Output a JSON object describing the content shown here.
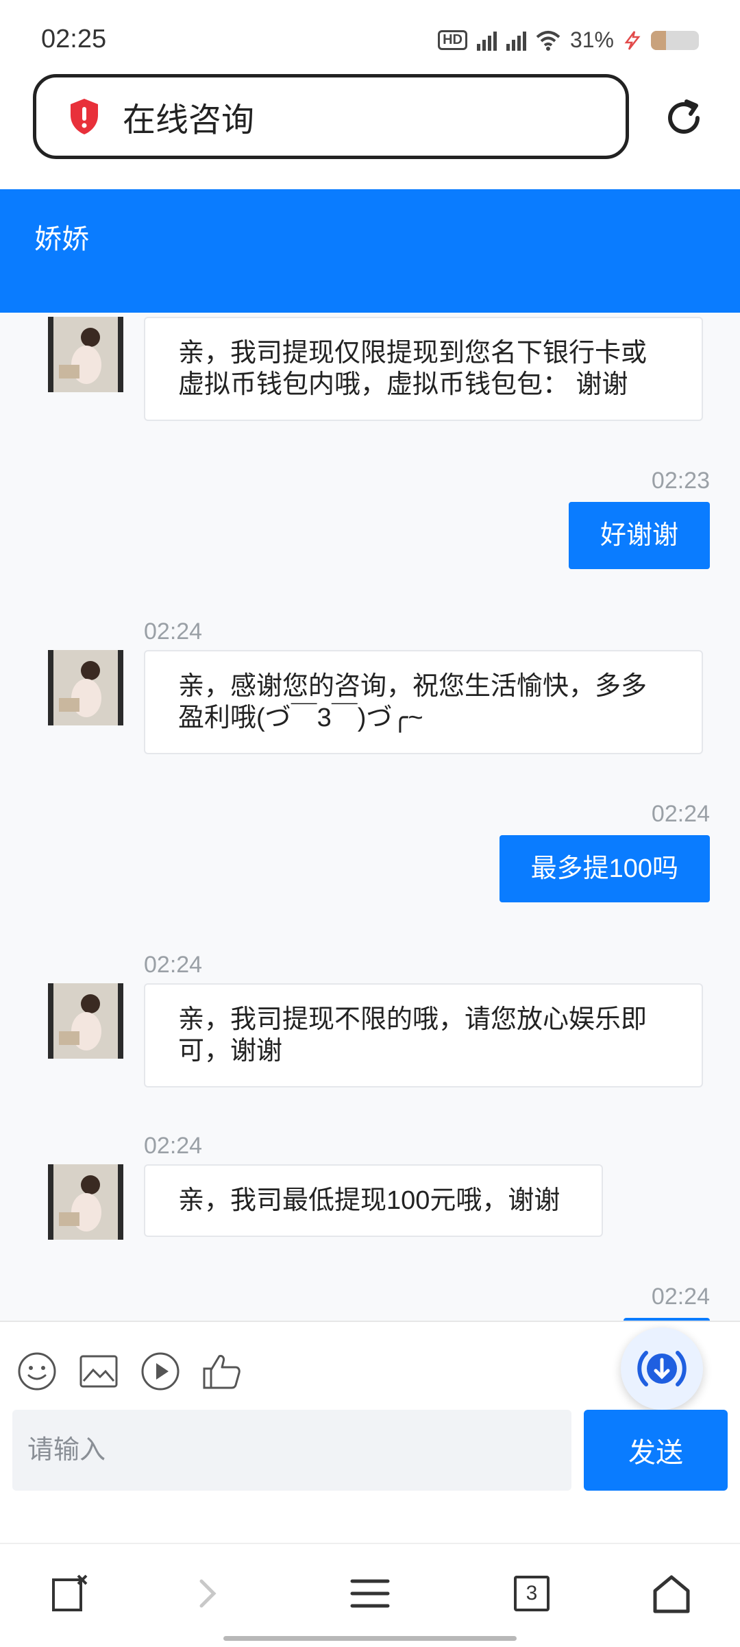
{
  "status": {
    "time": "02:25",
    "battery": "31%",
    "battery_level": 0.31
  },
  "browser": {
    "title": "在线咨询"
  },
  "chat": {
    "agent_name": "娇娇",
    "messages": [
      {
        "from": "agent",
        "time": "",
        "text": "亲，我司提现仅限提现到您名下银行卡或虚拟币钱包内哦，虚拟币钱包包： 谢谢"
      },
      {
        "from": "user",
        "time": "02:23",
        "text": "好谢谢"
      },
      {
        "from": "agent",
        "time": "02:24",
        "text": "亲，感谢您的咨询，祝您生活愉快，多多盈利哦(づ￣3￣)づ╭~"
      },
      {
        "from": "user",
        "time": "02:24",
        "text": "最多提100吗"
      },
      {
        "from": "agent",
        "time": "02:24",
        "text": "亲，我司提现不限的哦，请您放心娱乐即可，谢谢"
      },
      {
        "from": "agent",
        "time": "02:24",
        "text": "亲，我司最低提现100元哦，谢谢"
      },
      {
        "from": "user",
        "time": "02:24",
        "text": ""
      }
    ]
  },
  "composer": {
    "placeholder": "请输入",
    "send_label": "发送"
  },
  "nav": {
    "tabs_count": "3"
  },
  "colors": {
    "accent": "#0a7cff"
  }
}
